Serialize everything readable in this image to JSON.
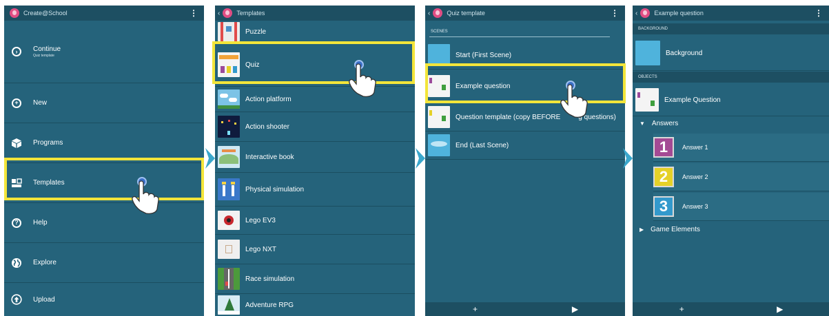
{
  "panel1": {
    "title": "Create@School",
    "menu": "⋮",
    "continue": {
      "label": "Continue",
      "sub": "Quiz template"
    },
    "items": [
      {
        "label": "New",
        "icon": "plus-circle-icon"
      },
      {
        "label": "Programs",
        "icon": "cube-icon"
      },
      {
        "label": "Templates",
        "icon": "templates-icon"
      },
      {
        "label": "Help",
        "icon": "help-icon"
      },
      {
        "label": "Explore",
        "icon": "globe-icon"
      },
      {
        "label": "Upload",
        "icon": "upload-icon"
      }
    ],
    "help_glyph": "?"
  },
  "panel2": {
    "back": "‹",
    "title": "Templates",
    "items": [
      {
        "label": "Puzzle"
      },
      {
        "label": "Quiz"
      },
      {
        "label": "Action platform"
      },
      {
        "label": "Action shooter"
      },
      {
        "label": "Interactive book"
      },
      {
        "label": "Physical simulation"
      },
      {
        "label": "Lego EV3"
      },
      {
        "label": "Lego NXT"
      },
      {
        "label": "Race simulation"
      },
      {
        "label": "Adventure RPG"
      }
    ]
  },
  "panel3": {
    "back": "‹",
    "title": "Quiz template",
    "menu": "⋮",
    "section": "SCENES",
    "scenes": [
      {
        "label": "Start (First Scene)"
      },
      {
        "label": "Example question"
      },
      {
        "label": "Question template (copy BEFORE"
      },
      {
        "label": "End (Last Scene)"
      }
    ],
    "scene_suffix": "g questions)",
    "bottom": {
      "add": "+",
      "play": "▶"
    }
  },
  "panel4": {
    "back": "‹",
    "title": "Example question",
    "menu": "⋮",
    "background_section": "BACKGROUND",
    "background_item": "Background",
    "objects_section": "OBJECTS",
    "object_item": "Example Question",
    "answers_group": "Answers",
    "answers_toggle": "▼",
    "answers": [
      {
        "num": "1",
        "label": "Answer 1",
        "color": "#a44a94"
      },
      {
        "num": "2",
        "label": "Answer 2",
        "color": "#e5d128"
      },
      {
        "num": "3",
        "label": "Answer 3",
        "color": "#3399cc"
      }
    ],
    "game_elements_toggle": "▶",
    "game_elements": "Game Elements",
    "bottom": {
      "add": "+",
      "play": "▶"
    }
  },
  "colors": {
    "highlight": "#f3e53a",
    "panel": "#25637b",
    "arrow": "#3aa7cc"
  }
}
